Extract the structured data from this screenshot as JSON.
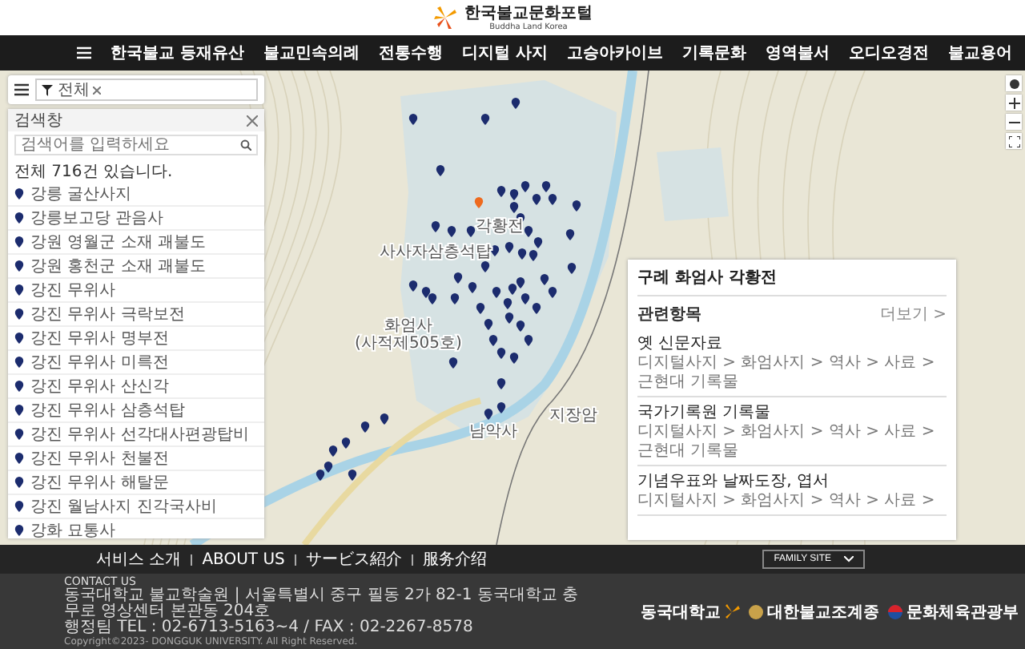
{
  "header": {
    "title": "한국불교문화포털",
    "subtitle": "Buddha Land Korea"
  },
  "nav": [
    "한국불교 등재유산",
    "불교민속의례",
    "전통수행",
    "디지털 사지",
    "고승아카이브",
    "기록문화",
    "영역불서",
    "오디오경전",
    "불교용어"
  ],
  "filter": {
    "tag": "전체"
  },
  "search_panel": {
    "title": "검색창",
    "placeholder": "검색어를 입력하세요",
    "count": "전체 716건 있습니다.",
    "results": [
      "강릉 굴산사지",
      "강릉보고당 관음사",
      "강원 영월군 소재 괘불도",
      "강원 홍천군 소재 괘불도",
      "강진 무위사",
      "강진 무위사 극락보전",
      "강진 무위사 명부전",
      "강진 무위사 미륵전",
      "강진 무위사 산신각",
      "강진 무위사 삼층석탑",
      "강진 무위사 선각대사편광탑비",
      "강진 무위사 천불전",
      "강진 무위사 해탈문",
      "강진 월남사지 진각국사비",
      "강화 묘통사"
    ]
  },
  "map": {
    "labels": [
      "각황전",
      "사사자삼층석탑",
      "화엄사",
      "(사적제505호)",
      "지장암",
      "남악사"
    ]
  },
  "info_panel": {
    "title": "구례 화엄사 각황전",
    "section": "관련항목",
    "more": "더보기 >",
    "items": [
      {
        "title": "옛 신문자료",
        "path": "디지털사지 > 화엄사지 > 역사 > 사료 > 근현대 기록물"
      },
      {
        "title": "국가기록원 기록물",
        "path": "디지털사지 > 화엄사지 > 역사 > 사료 > 근현대 기록물"
      },
      {
        "title": "기념우표와 날짜도장, 엽서",
        "path": "디지털사지 > 화엄사지 > 역사 > 사료 >"
      }
    ]
  },
  "footer": {
    "links": [
      "서비스 소개",
      "ABOUT US",
      "サービス紹介",
      "服务介绍"
    ],
    "family_site": "FAMILY SITE",
    "contact_title": "CONTACT US",
    "lines": [
      "동국대학교 불교학술원 | 서울특별시 중구 필동 2가 82-1 동국대학교 충무로 영상센터 본관동 204호",
      "행정팀 TEL : 02-6713-5163~4 / FAX : 02-2267-8578"
    ],
    "copyright": "Copyright©2023- DONGGUK UNIVERSITY. All Right Reserved.",
    "logos": [
      "동국대학교",
      "대한불교조계종",
      "문화체육관광부"
    ]
  }
}
